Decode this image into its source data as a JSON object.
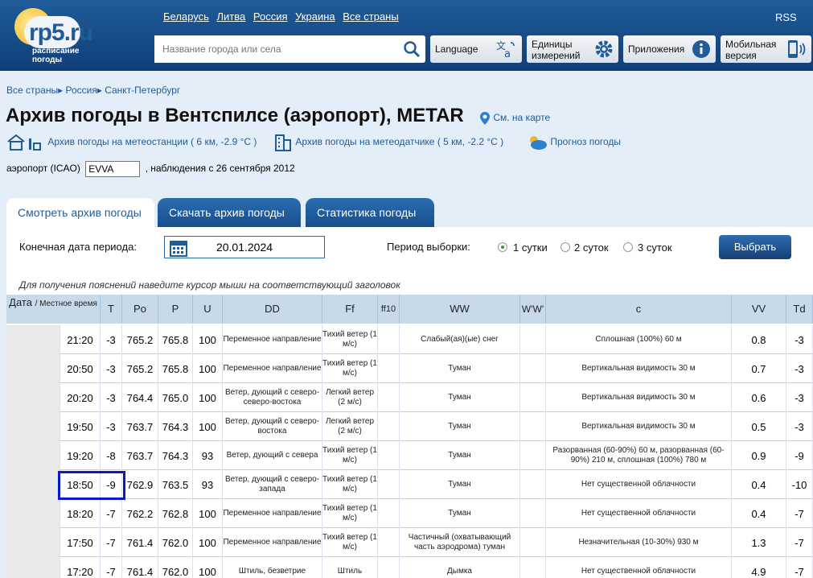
{
  "header": {
    "logo_text": "rp5.ru",
    "logo_sub": "расписание погоды",
    "links": [
      "Беларусь",
      "Литва",
      "Россия",
      "Украина",
      "Все страны"
    ],
    "rss": "RSS",
    "search_placeholder": "Название города или села",
    "btn_language": "Language",
    "btn_units": "Единицы измерений",
    "btn_apps": "Приложения",
    "btn_mobile": "Мобильная версия"
  },
  "breadcrumb": [
    "Все страны",
    "Россия",
    "Санкт-Петербург"
  ],
  "title": "Архив погоды в Вентспилсе (аэропорт), METAR",
  "map_link": "См. на карте",
  "link_station": "Архив погоды на метеостанции ( 6 км, -2.9 °C )",
  "link_sensor": "Архив погоды на метеодатчике ( 5 км, -2.2 °C )",
  "link_forecast": "Прогноз погоды",
  "icao": {
    "label": "аэропорт (ICAO)",
    "value": "EVVA",
    "since": ", наблюдения с 26 сентября 2012"
  },
  "tabs": [
    "Смотреть архив погоды",
    "Скачать архив погоды",
    "Статистика погоды"
  ],
  "form": {
    "end_date_label": "Конечная дата периода:",
    "end_date": "20.01.2024",
    "period_label": "Период выборки:",
    "opt1": "1 сутки",
    "opt2": "2 суток",
    "opt3": "3 суток",
    "submit": "Выбрать"
  },
  "hint": "Для получения пояснений наведите курсор мыши на соответствующий заголовок",
  "columns": {
    "date": "Дата",
    "local": "/ Местное время",
    "t": "T",
    "po": "Po",
    "p": "P",
    "u": "U",
    "dd": "DD",
    "ff": "Ff",
    "ff10": "ff10",
    "ww": "WW",
    "ww2": "W'W'",
    "c": "c",
    "vv": "VV",
    "td": "Td"
  },
  "rows": [
    {
      "time": "21:20",
      "t": "-3",
      "po": "765.2",
      "p": "765.8",
      "u": "100",
      "dd": "Переменное направление",
      "ff": "Тихий ветер (1 м/с)",
      "ww": "Слабый(ая)(ые) снег",
      "c": "Сплошная (100%) 60 м",
      "vv": "0.8",
      "td": "-3"
    },
    {
      "time": "20:50",
      "t": "-3",
      "po": "765.2",
      "p": "765.8",
      "u": "100",
      "dd": "Переменное направление",
      "ff": "Тихий ветер (1 м/с)",
      "ww": "Туман",
      "c": "Вертикальная видимость 30 м",
      "vv": "0.7",
      "td": "-3"
    },
    {
      "time": "20:20",
      "t": "-3",
      "po": "764.4",
      "p": "765.0",
      "u": "100",
      "dd": "Ветер, дующий с северо-северо-востока",
      "ff": "Легкий ветер (2 м/с)",
      "ww": "Туман",
      "c": "Вертикальная видимость 30 м",
      "vv": "0.6",
      "td": "-3"
    },
    {
      "time": "19:50",
      "t": "-3",
      "po": "763.7",
      "p": "764.3",
      "u": "100",
      "dd": "Ветер, дующий с северо-востока",
      "ff": "Легкий ветер (2 м/с)",
      "ww": "Туман",
      "c": "Вертикальная видимость 30 м",
      "vv": "0.5",
      "td": "-3"
    },
    {
      "time": "19:20",
      "t": "-8",
      "po": "763.7",
      "p": "764.3",
      "u": "93",
      "dd": "Ветер, дующий с севера",
      "ff": "Тихий ветер (1 м/с)",
      "ww": "Туман",
      "c": "Разорванная (60-90%) 60 м, разорванная (60-90%) 210 м, сплошная (100%) 780 м",
      "vv": "0.9",
      "td": "-9"
    },
    {
      "time": "18:50",
      "t": "-9",
      "po": "762.9",
      "p": "763.5",
      "u": "93",
      "dd": "Ветер, дующий с северо-запада",
      "ff": "Тихий ветер (1 м/с)",
      "ww": "Туман",
      "c": "Нет существенной облачности",
      "vv": "0.4",
      "td": "-10"
    },
    {
      "time": "18:20",
      "t": "-7",
      "po": "762.2",
      "p": "762.8",
      "u": "100",
      "dd": "Переменное направление",
      "ff": "Тихий ветер (1 м/с)",
      "ww": "Туман",
      "c": "Нет существенной облачности",
      "vv": "0.4",
      "td": "-7"
    },
    {
      "time": "17:50",
      "t": "-7",
      "po": "761.4",
      "p": "762.0",
      "u": "100",
      "dd": "Переменное направление",
      "ff": "Тихий ветер (1 м/с)",
      "ww": "Частичный (охватывающий часть аэродрома) туман",
      "c": "Незначительная (10-30%) 930 м",
      "vv": "1.3",
      "td": "-7"
    },
    {
      "time": "17:20",
      "t": "-7",
      "po": "761.4",
      "p": "762.0",
      "u": "100",
      "dd": "Штиль, безветрие",
      "ff": "Штиль",
      "ww": "Дымка",
      "c": "Нет существенной облачности",
      "vv": "4.9",
      "td": "-7"
    }
  ]
}
